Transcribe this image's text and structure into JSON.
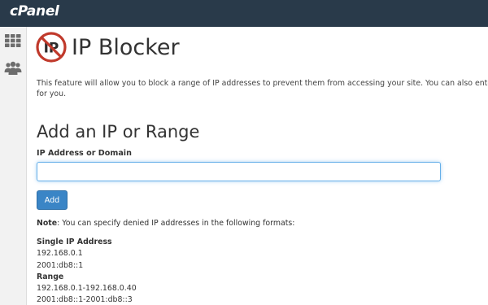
{
  "app": {
    "logo_text": "cPanel",
    "colors": {
      "topbar": "#293a4a",
      "accent": "#3a85c6",
      "input_focus": "#66afe9",
      "icon_red": "#c0392b"
    }
  },
  "sidebar": {
    "items": [
      {
        "icon": "grid-icon"
      },
      {
        "icon": "users-icon"
      }
    ]
  },
  "page": {
    "icon": "ip-blocker-icon",
    "title": "IP Blocker",
    "description_line1": "This feature will allow you to block a range of IP addresses to prevent them from accessing your site. You can also enter",
    "description_line2": "for you."
  },
  "form": {
    "heading": "Add an IP or Range",
    "field_label": "IP Address or Domain",
    "field_value": "",
    "field_placeholder": "",
    "submit_label": "Add"
  },
  "note": {
    "prefix": "Note",
    "text": ": You can specify denied IP addresses in the following formats:"
  },
  "formats": [
    {
      "title": "Single IP Address",
      "examples": [
        "192.168.0.1",
        "2001:db8::1"
      ]
    },
    {
      "title": "Range",
      "examples": [
        "192.168.0.1-192.168.0.40",
        "2001:db8::1-2001:db8::3"
      ]
    }
  ]
}
